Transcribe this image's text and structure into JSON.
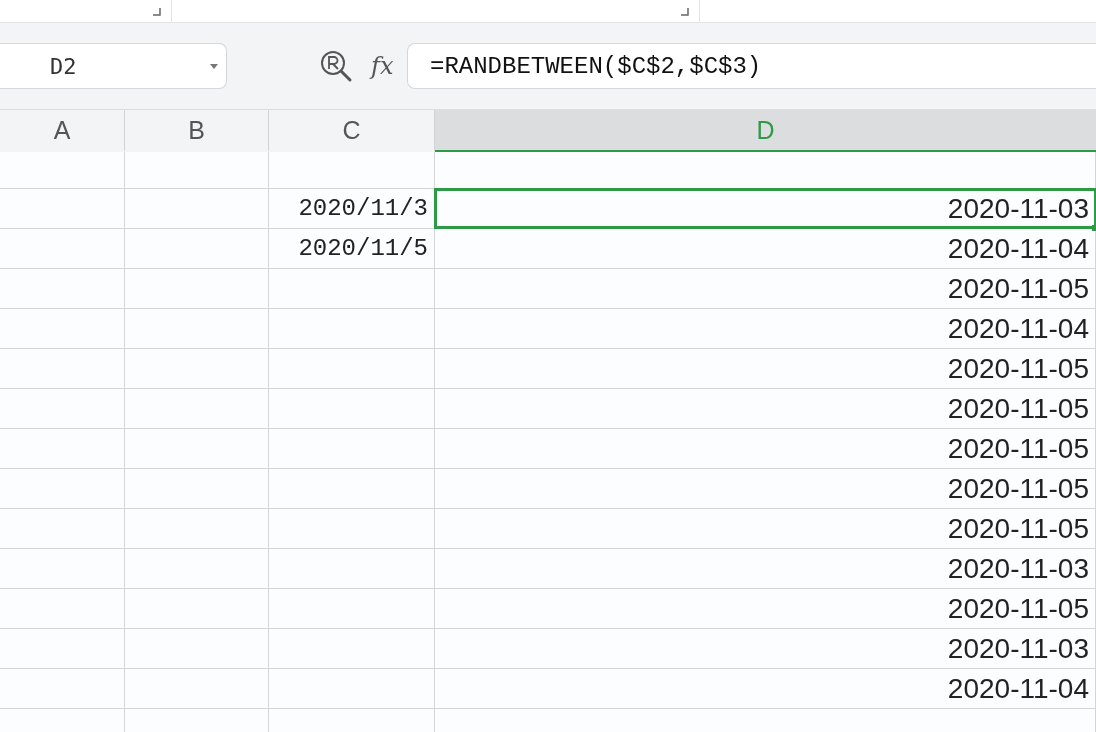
{
  "name_box": {
    "value": "D2"
  },
  "formula_bar": {
    "label": "fx",
    "value": "=RANDBETWEEN($C$2,$C$3)"
  },
  "columns": [
    {
      "label": "A",
      "selected": false
    },
    {
      "label": "B",
      "selected": false
    },
    {
      "label": "C",
      "selected": false
    },
    {
      "label": "D",
      "selected": true
    }
  ],
  "rows": [
    {},
    {
      "column_c": "2020/11/3",
      "column_d": {
        "text": "2020-11-03",
        "selected": true
      }
    },
    {
      "column_c": "2020/11/5",
      "column_d": {
        "text": "2020-11-04",
        "selected": false
      }
    },
    {
      "column_d": {
        "text": "2020-11-05",
        "selected": false
      }
    },
    {
      "column_d": {
        "text": "2020-11-04",
        "selected": false
      }
    },
    {
      "column_d": {
        "text": "2020-11-05",
        "selected": false
      }
    },
    {
      "column_d": {
        "text": "2020-11-05",
        "selected": false
      }
    },
    {
      "column_d": {
        "text": "2020-11-05",
        "selected": false
      }
    },
    {
      "column_d": {
        "text": "2020-11-05",
        "selected": false
      }
    },
    {
      "column_d": {
        "text": "2020-11-05",
        "selected": false
      }
    },
    {
      "column_d": {
        "text": "2020-11-03",
        "selected": false
      }
    },
    {
      "column_d": {
        "text": "2020-11-05",
        "selected": false
      }
    },
    {
      "column_d": {
        "text": "2020-11-03",
        "selected": false
      }
    },
    {
      "column_d": {
        "text": "2020-11-04",
        "selected": false
      }
    },
    {}
  ]
}
